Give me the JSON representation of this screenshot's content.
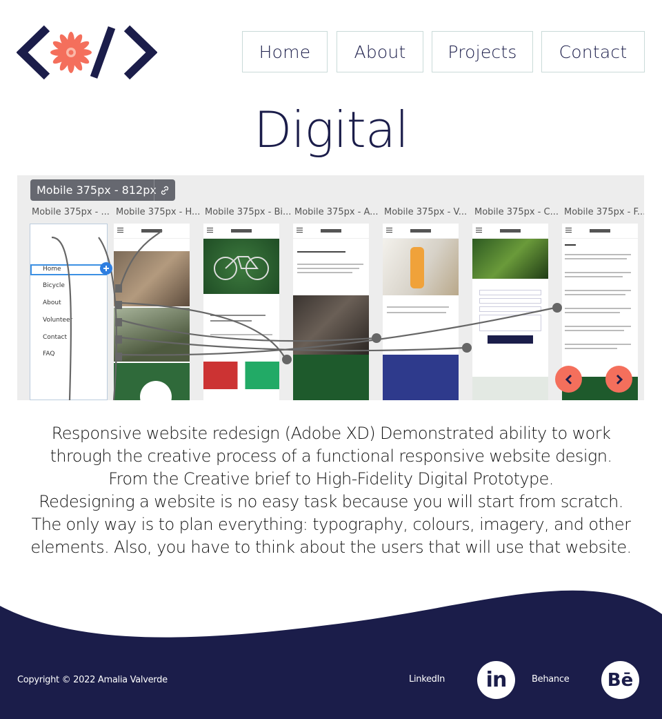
{
  "brand": {
    "logo_alt": "code bracket logo with flower",
    "accent": "#f46f5c",
    "navy": "#1b1d4a"
  },
  "nav": [
    {
      "label": "Home"
    },
    {
      "label": "About"
    },
    {
      "label": "Projects"
    },
    {
      "label": "Contact"
    }
  ],
  "page": {
    "title": "Digital"
  },
  "carousel": {
    "chip": "Mobile 375px - 812px",
    "artboard_labels": [
      "Mobile 375px - ...",
      "Mobile 375px - H...",
      "Mobile 375px - Bi...",
      "Mobile 375px - A...",
      "Mobile 375px - V...",
      "Mobile 375px - C...",
      "Mobile 375px - F..."
    ],
    "menu_items": [
      "Home",
      "Bicycle",
      "About",
      "Volunteer",
      "Contact",
      "FAQ"
    ],
    "prev_icon": "chevron-left-icon",
    "next_icon": "chevron-right-icon"
  },
  "description": {
    "lines": [
      "Responsive website redesign (Adobe XD) Demonstrated ability to work",
      "through the creative process of a functional responsive website design.",
      "From the Creative brief to High-Fidelity Digital Prototype.",
      "Redesigning a website is no easy task because you will start from scratch.",
      "The only way is to plan everything: typography, colours, imagery, and other",
      "elements. Also, you have to think about the users that will use that website."
    ]
  },
  "footer": {
    "copyright": "Copyright © 2022 Amalia Valverde",
    "linkedin_label": "LinkedIn",
    "linkedin_icon_text": "in",
    "behance_label": "Behance",
    "behance_icon_text": "Bē",
    "background": "#1b1d4a"
  }
}
